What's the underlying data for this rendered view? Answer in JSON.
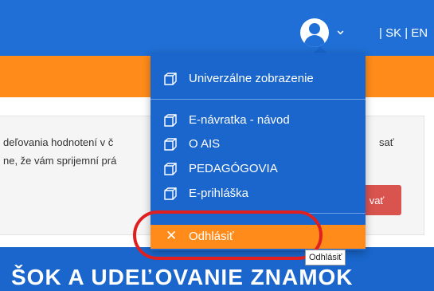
{
  "header": {
    "language_links": "| SK | EN",
    "user_menu_toggle": "user-account"
  },
  "background": {
    "panel_line1_left": "deľovania hodnotení v č",
    "panel_line1_right": "sať",
    "panel_line2": "ne, že vám sprijemní prá",
    "action_button": "vať",
    "banner_text": "ŠOK A UDEĽOVANIE ZNAMOK"
  },
  "dropdown": {
    "items": [
      {
        "label": "Univerzálne zobrazenie",
        "icon": "cube-icon"
      },
      {
        "label": "E-návratka - návod",
        "icon": "cube-icon"
      },
      {
        "label": "O AIS",
        "icon": "cube-icon"
      },
      {
        "label": "PEDAGÓGOVIA",
        "icon": "cube-icon"
      },
      {
        "label": "E-prihláška",
        "icon": "cube-icon"
      }
    ],
    "logout_label": "Odhlásiť"
  },
  "tooltip": {
    "text": "Odhlásiť"
  },
  "colors": {
    "header_blue": "#1f6fd6",
    "accent_orange": "#ff8c1a",
    "highlight_red": "#e02020"
  }
}
